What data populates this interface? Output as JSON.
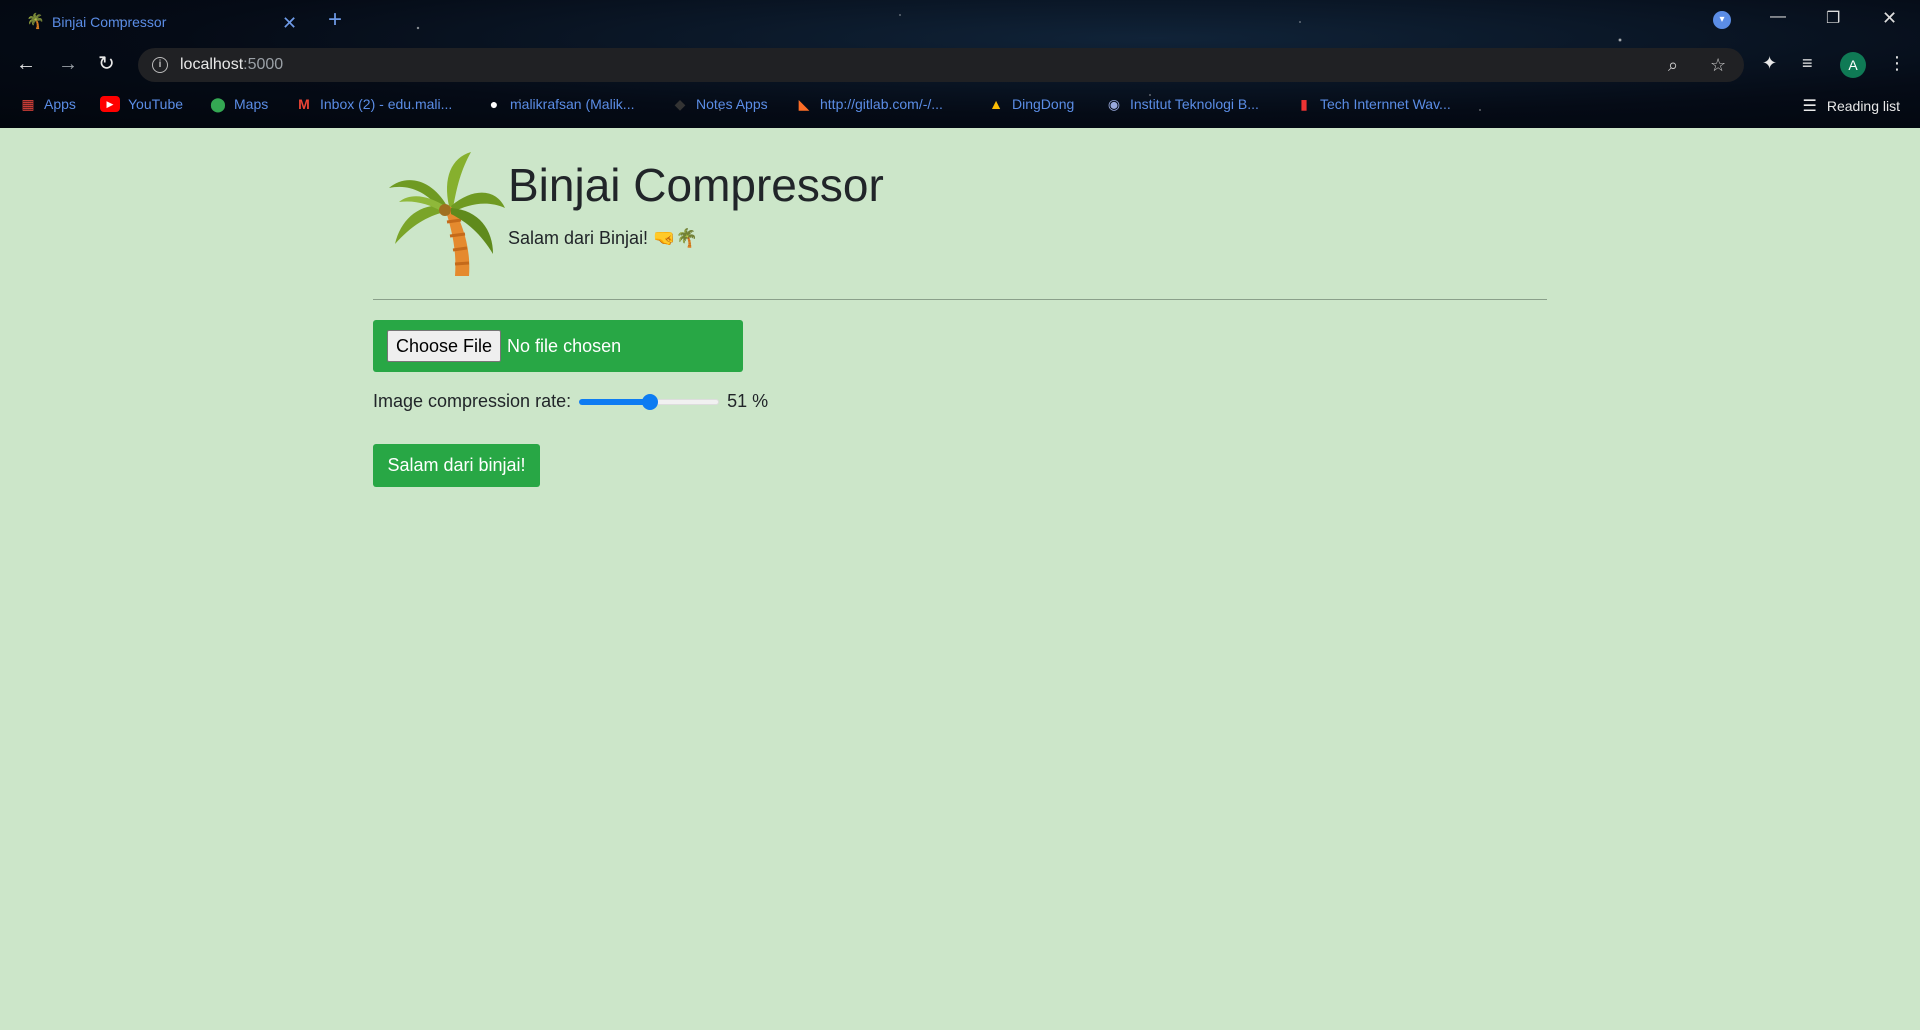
{
  "browser": {
    "tab_title": "Binjai Compressor",
    "tab_favicon": "🌴",
    "new_tab": "+",
    "close_tab": "✕",
    "url_host": "localhost",
    "url_port": ":5000",
    "avatar_letter": "A",
    "reading_list": "Reading list"
  },
  "bookmarks": [
    {
      "label": "Apps",
      "icon": "apps-grid-icon"
    },
    {
      "label": "YouTube",
      "icon": "youtube-icon"
    },
    {
      "label": "Maps",
      "icon": "maps-icon"
    },
    {
      "label": "Inbox (2) - edu.mali...",
      "icon": "gmail-icon"
    },
    {
      "label": "malikrafsan (Malik...",
      "icon": "github-icon"
    },
    {
      "label": "Notes Apps",
      "icon": "notes-icon"
    },
    {
      "label": "http://gitlab.com/-/...",
      "icon": "gitlab-icon"
    },
    {
      "label": "DingDong",
      "icon": "drive-icon"
    },
    {
      "label": "Institut Teknologi B...",
      "icon": "itb-icon"
    },
    {
      "label": "Tech Internnet Wav...",
      "icon": "tech-icon"
    }
  ],
  "page": {
    "title": "Binjai Compressor",
    "subtitle": "Salam dari Binjai! 🤜🌴",
    "choose_file_label": "Choose File",
    "no_file_text": "No file chosen",
    "rate_label": "Image compression rate:",
    "rate_value": "51",
    "rate_unit": "%",
    "rate_fraction": 0.51,
    "submit_label": "Salam dari binjai!"
  },
  "colors": {
    "page_bg": "#cce6c9",
    "accent_green": "#28a745",
    "slider_blue": "#0d7cf2",
    "link_blue": "#5b8de6"
  }
}
